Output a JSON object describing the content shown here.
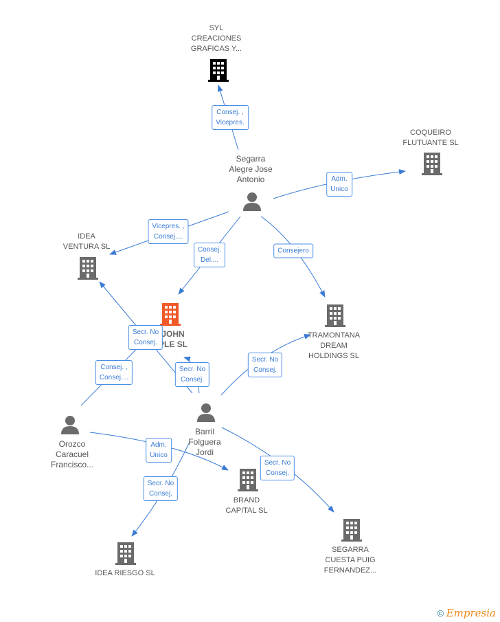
{
  "nodes": {
    "syl": {
      "lines": [
        "SYL",
        "CREACIONES",
        "GRAFICAS Y..."
      ],
      "type": "company"
    },
    "coqueiro": {
      "lines": [
        "COQUEIRO",
        "FLUTUANTE SL"
      ],
      "type": "company"
    },
    "segarra_alegre": {
      "lines": [
        "Segarra",
        "Alegre Jose",
        "Antonio"
      ],
      "type": "person"
    },
    "idea_ventura": {
      "lines": [
        "IDEA",
        "VENTURA SL"
      ],
      "type": "company"
    },
    "john": {
      "lines": [
        "JOHN",
        "PLE SL"
      ],
      "type": "company-main"
    },
    "tramontana": {
      "lines": [
        "TRAMONTANA",
        "DREAM",
        "HOLDINGS SL"
      ],
      "type": "company"
    },
    "orozco": {
      "lines": [
        "Orozco",
        "Caracuel",
        "Francisco..."
      ],
      "type": "person"
    },
    "barril": {
      "lines": [
        "Barril",
        "Folguera",
        "Jordi"
      ],
      "type": "person"
    },
    "brand": {
      "lines": [
        "BRAND",
        "CAPITAL SL"
      ],
      "type": "company"
    },
    "segarra_cuesta": {
      "lines": [
        "SEGARRA",
        "CUESTA PUIG",
        "FERNANDEZ..."
      ],
      "type": "company"
    },
    "idea_riesgo": {
      "lines": [
        "IDEA RIESGO  SL"
      ],
      "type": "company"
    }
  },
  "edges": [
    {
      "lines": [
        "Consej. ,",
        "Vicepres."
      ]
    },
    {
      "lines": [
        "Adm.",
        "Unico"
      ]
    },
    {
      "lines": [
        "Vicepres. ,",
        "Consej...."
      ]
    },
    {
      "lines": [
        "Consej.",
        "Del...."
      ]
    },
    {
      "lines": [
        "Consejero"
      ]
    },
    {
      "lines": [
        "Secr.  No",
        "Consej."
      ]
    },
    {
      "lines": [
        "Consej. ,",
        "Consej...."
      ]
    },
    {
      "lines": [
        "Secr.  No",
        "Consej."
      ]
    },
    {
      "lines": [
        "Secr.  No",
        "Consej."
      ]
    },
    {
      "lines": [
        "Adm.",
        "Unico"
      ]
    },
    {
      "lines": [
        "Secr.  No",
        "Consej."
      ]
    },
    {
      "lines": [
        "Secr.  No",
        "Consej."
      ]
    }
  ],
  "colors": {
    "edge": "#3a7bd5",
    "company": "#6b6b6b",
    "main": "#f05a28"
  },
  "footer": {
    "copyright": "©",
    "brand": "Empresia"
  }
}
